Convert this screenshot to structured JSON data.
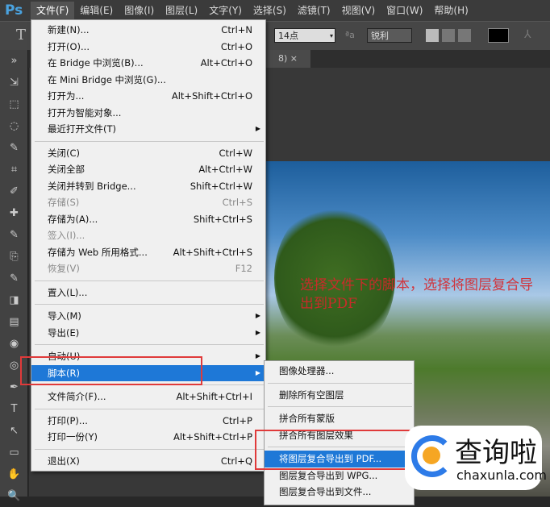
{
  "app": {
    "logo": "Ps"
  },
  "menubar": [
    "文件(F)",
    "编辑(E)",
    "图像(I)",
    "图层(L)",
    "文字(Y)",
    "选择(S)",
    "滤镜(T)",
    "视图(V)",
    "窗口(W)",
    "帮助(H)"
  ],
  "options": {
    "tool_glyph": "T",
    "font_size": "14点",
    "aa_icon": "ªa",
    "antialias": "锐利"
  },
  "doc_tab": {
    "label": "8) ×"
  },
  "file_menu": [
    {
      "label": "新建(N)...",
      "shortcut": "Ctrl+N"
    },
    {
      "label": "打开(O)...",
      "shortcut": "Ctrl+O"
    },
    {
      "label": "在 Bridge 中浏览(B)...",
      "shortcut": "Alt+Ctrl+O"
    },
    {
      "label": "在 Mini Bridge 中浏览(G)...",
      "shortcut": ""
    },
    {
      "label": "打开为...",
      "shortcut": "Alt+Shift+Ctrl+O"
    },
    {
      "label": "打开为智能对象...",
      "shortcut": ""
    },
    {
      "label": "最近打开文件(T)",
      "shortcut": "",
      "submenu": true
    },
    {
      "sep": true
    },
    {
      "label": "关闭(C)",
      "shortcut": "Ctrl+W"
    },
    {
      "label": "关闭全部",
      "shortcut": "Alt+Ctrl+W"
    },
    {
      "label": "关闭并转到 Bridge...",
      "shortcut": "Shift+Ctrl+W"
    },
    {
      "label": "存储(S)",
      "shortcut": "Ctrl+S",
      "disabled": true
    },
    {
      "label": "存储为(A)...",
      "shortcut": "Shift+Ctrl+S"
    },
    {
      "label": "签入(I)...",
      "shortcut": "",
      "disabled": true
    },
    {
      "label": "存储为 Web 所用格式...",
      "shortcut": "Alt+Shift+Ctrl+S"
    },
    {
      "label": "恢复(V)",
      "shortcut": "F12",
      "disabled": true
    },
    {
      "sep": true
    },
    {
      "label": "置入(L)...",
      "shortcut": ""
    },
    {
      "sep": true
    },
    {
      "label": "导入(M)",
      "shortcut": "",
      "submenu": true
    },
    {
      "label": "导出(E)",
      "shortcut": "",
      "submenu": true
    },
    {
      "sep": true
    },
    {
      "label": "自动(U)",
      "shortcut": "",
      "submenu": true
    },
    {
      "label": "脚本(R)",
      "shortcut": "",
      "submenu": true,
      "highlighted": true
    },
    {
      "sep": true
    },
    {
      "label": "文件简介(F)...",
      "shortcut": "Alt+Shift+Ctrl+I"
    },
    {
      "sep": true
    },
    {
      "label": "打印(P)...",
      "shortcut": "Ctrl+P"
    },
    {
      "label": "打印一份(Y)",
      "shortcut": "Alt+Shift+Ctrl+P"
    },
    {
      "sep": true
    },
    {
      "label": "退出(X)",
      "shortcut": "Ctrl+Q"
    }
  ],
  "script_submenu": [
    {
      "label": "图像处理器..."
    },
    {
      "sep": true
    },
    {
      "label": "删除所有空图层"
    },
    {
      "sep": true
    },
    {
      "label": "拼合所有蒙版"
    },
    {
      "label": "拼合所有图层效果"
    },
    {
      "sep": true
    },
    {
      "label": "将图层复合导出到 PDF...",
      "highlighted": true
    },
    {
      "label": "图层复合导出到 WPG..."
    },
    {
      "label": "图层复合导出到文件..."
    }
  ],
  "annotation": "选择文件下的脚本，选择将图层复合导出到PDF",
  "watermark": {
    "title": "查询啦",
    "url": "chaxunla.com"
  },
  "colors": {
    "highlight": "#1e78d7",
    "annotation": "#d8262b"
  }
}
